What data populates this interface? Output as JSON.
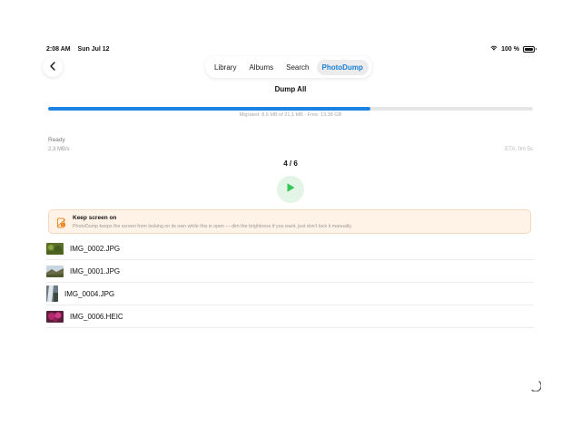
{
  "status_bar": {
    "time": "2:08 AM",
    "date": "Sun Jul 12",
    "battery": "100 %"
  },
  "nav": {
    "tabs": [
      {
        "label": "Library"
      },
      {
        "label": "Albums"
      },
      {
        "label": "Search"
      },
      {
        "label": "PhotoDump"
      }
    ],
    "active_tab": "PhotoDump"
  },
  "main": {
    "title": "Dump All",
    "progress_fraction": 0.665,
    "migrated_text": "Migrated: 8,6 MB of 21,1 MB · Free: 13,38 GB",
    "status": "Ready",
    "speed": "2,3 MB/s",
    "eta": "ETA: 0m 5s",
    "count": "4 / 6"
  },
  "banner": {
    "title": "Keep screen on",
    "text": "PhotoDump keeps the screen from locking on its own while this is open — dim the brightness if you want, just don't lock it manually."
  },
  "files": [
    {
      "name": "IMG_0002.JPG"
    },
    {
      "name": "IMG_0001.JPG"
    },
    {
      "name": "IMG_0004.JPG"
    },
    {
      "name": "IMG_0006.HEIC"
    }
  ],
  "colors": {
    "accent": "#1a84e0",
    "play": "#34c759",
    "banner_bg": "#fff3e8",
    "warning": "#f08a24"
  }
}
